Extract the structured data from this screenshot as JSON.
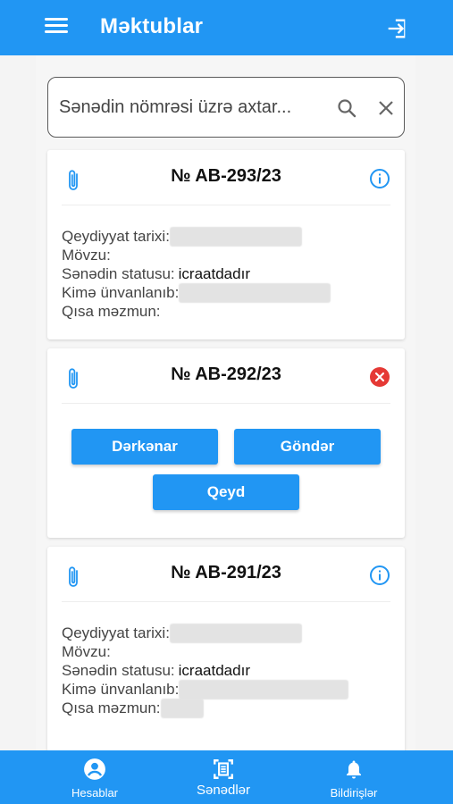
{
  "header": {
    "title": "Məktublar",
    "menu_icon": "menu-icon",
    "exit_icon": "exit-icon"
  },
  "search": {
    "placeholder": "Sənədin nömrəsi üzrə axtar..."
  },
  "labels": {
    "reg_date": "Qeydiyyat tarixi:",
    "subject": "Mövzu:",
    "status": "Sənədin statusu:",
    "addressed": "Kimə ünvanlanıb:",
    "summary": "Qısa məzmun:"
  },
  "cards": [
    {
      "number": "№ AB-293/23",
      "status": "icraatdadır",
      "action_icon": "info-icon"
    },
    {
      "number": "№ AB-292/23",
      "action_icon": "close-circle-icon",
      "buttons": {
        "derkenar": "Dərkənar",
        "gonder": "Göndər",
        "qeyd": "Qeyd"
      }
    },
    {
      "number": "№ AB-291/23",
      "status": "icraatdadır",
      "action_icon": "info-icon"
    }
  ],
  "bottom_nav": [
    {
      "label": "Hesablar",
      "icon": "account-circle-icon"
    },
    {
      "label": "Sənədlər",
      "icon": "document-scan-icon"
    },
    {
      "label": "Bildirişlər",
      "icon": "bell-icon"
    }
  ],
  "colors": {
    "primary": "#2196f3",
    "error": "#e53935"
  }
}
